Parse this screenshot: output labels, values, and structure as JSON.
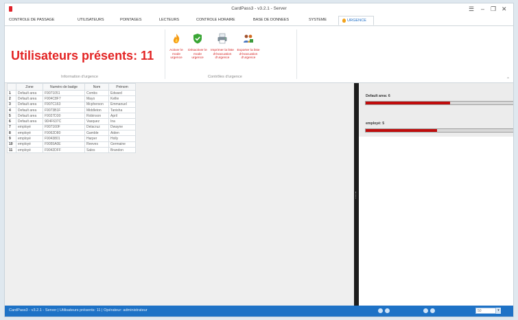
{
  "window": {
    "title": "CardPass3 - v3.2.1 - Server"
  },
  "tabs": [
    {
      "label": "CONTROLE DE PASSAGE"
    },
    {
      "label": "UTILISATEURS"
    },
    {
      "label": "POINTAGES"
    },
    {
      "label": "LECTEURS"
    },
    {
      "label": "CONTROLE HORAIRE"
    },
    {
      "label": "BASE DE DONNEES"
    },
    {
      "label": "SYSTEME"
    },
    {
      "label": "URGENCE",
      "active": true
    }
  ],
  "ribbon": {
    "big_title": "Utilisateurs présents: 11",
    "info_group_label": "Information d'urgence",
    "controls_group_label": "Contrôles d'urgence",
    "buttons": [
      {
        "label": "Activer le mode urgence",
        "icon": "flame-icon"
      },
      {
        "label": "Désactiver le mode urgence",
        "icon": "check-shield-icon"
      },
      {
        "label": "Imprimer la liste d'évacuation d'urgence",
        "icon": "printer-icon"
      },
      {
        "label": "Exporter la liste d'évacuation d'urgence",
        "icon": "people-export-icon"
      }
    ]
  },
  "grid": {
    "headers": [
      "Zone",
      "Numéro de badge",
      "Nom",
      "Prénom"
    ],
    "rows": [
      {
        "n": "1",
        "zone": "Default area",
        "badge": "F9071051",
        "nom": "Combs",
        "prenom": "Edward"
      },
      {
        "n": "2",
        "zone": "Default area",
        "badge": "F904C8F7",
        "nom": "Mayo",
        "prenom": "Kellie"
      },
      {
        "n": "3",
        "zone": "Default area",
        "badge": "F907C163",
        "nom": "Mcpherson",
        "prenom": "Emmanuel"
      },
      {
        "n": "4",
        "zone": "Default area",
        "badge": "F9073B1F",
        "nom": "Middleton",
        "prenom": "Tanisha"
      },
      {
        "n": "5",
        "zone": "Default area",
        "badge": "F9027D30",
        "nom": "Robinson",
        "prenom": "April"
      },
      {
        "n": "6",
        "zone": "Default area",
        "badge": "9D4F637C",
        "nom": "Vasquez",
        "prenom": "Ina"
      },
      {
        "n": "7",
        "zone": "employé",
        "badge": "F907160F",
        "nom": "Delacruz",
        "prenom": "Dwayne"
      },
      {
        "n": "8",
        "zone": "employé",
        "badge": "F9062D80",
        "nom": "Gamble",
        "prenom": "Aiden"
      },
      {
        "n": "9",
        "zone": "employé",
        "badge": "F9043801",
        "nom": "Harper",
        "prenom": "Holly"
      },
      {
        "n": "10",
        "zone": "employé",
        "badge": "F9055A0E",
        "nom": "Reeves",
        "prenom": "Germaine"
      },
      {
        "n": "11",
        "zone": "employé",
        "badge": "F9042DFF",
        "nom": "Sales",
        "prenom": "Brandon"
      }
    ]
  },
  "zones": [
    {
      "label": "Default area: 6",
      "fill_fraction": 0.57
    },
    {
      "label": "employé: 5",
      "fill_fraction": 0.48
    }
  ],
  "statusbar": {
    "text": "CardPass3 - v3.2.1 - Server   |   Utilisateurs présents: 11   |   Opérateur: administrateur",
    "input_value": "50"
  },
  "colors": {
    "accent": "#1e72c6",
    "alert": "#e32424",
    "bar_fill": "#c00c0c"
  }
}
